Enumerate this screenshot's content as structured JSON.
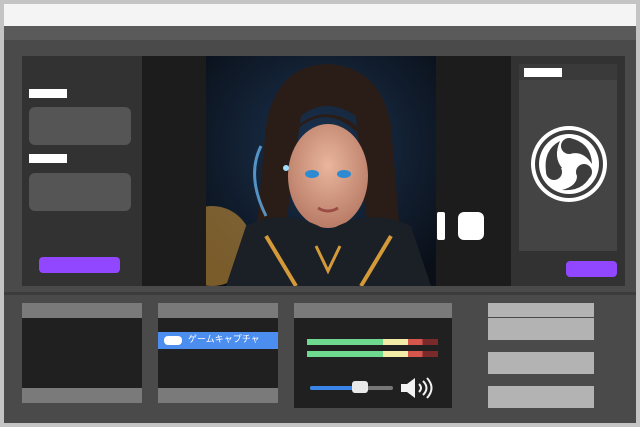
{
  "source_item": {
    "label": "ゲームキャプチャ"
  },
  "colors": {
    "accent_purple": "#9146ff",
    "source_highlight": "#4c8df0",
    "volume_fill": "#3a86e8"
  },
  "icons": {
    "app_logo": "obs-logo-icon",
    "volume": "speaker-volume-icon",
    "source_type": "gamepad-icon",
    "pause": "pause-icon",
    "stop": "stop-icon"
  },
  "audio": {
    "volume_level": 0.6
  }
}
